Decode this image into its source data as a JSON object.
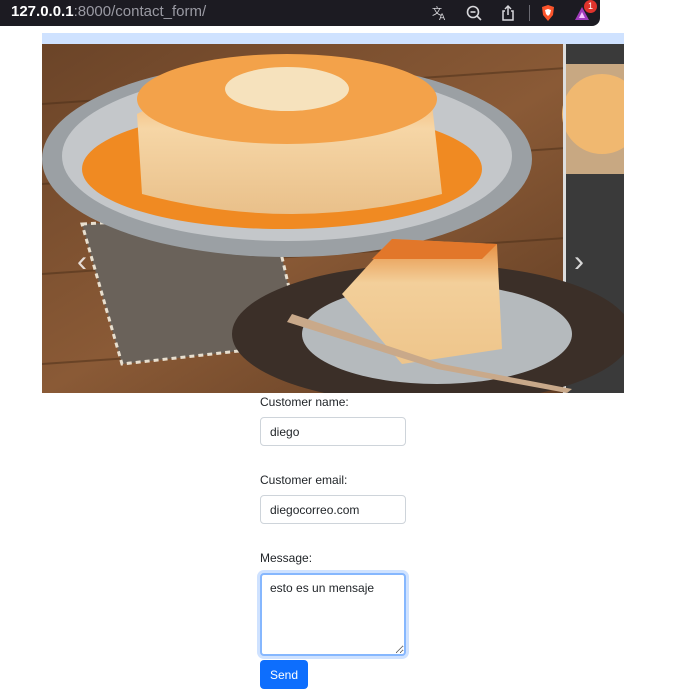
{
  "browser": {
    "url_host": "127.0.0.1",
    "url_rest": ":8000/contact_form/",
    "toolbar_icons": [
      "translate-icon",
      "zoom-out-icon",
      "share-icon",
      "brave-shield-icon",
      "brave-rewards-icon"
    ],
    "notification_count": "1",
    "colors": {
      "toolbar_bg": "#1c1b22",
      "badge": "#e0332c"
    }
  },
  "carousel": {
    "prev_icon": "chevron-left-icon",
    "next_icon": "chevron-right-icon",
    "image": "flan-dessert-photo"
  },
  "form": {
    "name_label": "Customer name:",
    "name_value": "diego",
    "email_label": "Customer email:",
    "email_value": "diegocorreo.com",
    "message_label": "Message:",
    "message_value": "esto es un mensaje",
    "send_label": "Send",
    "colors": {
      "primary": "#0d6efd",
      "focus_border": "#86b7fe"
    }
  }
}
